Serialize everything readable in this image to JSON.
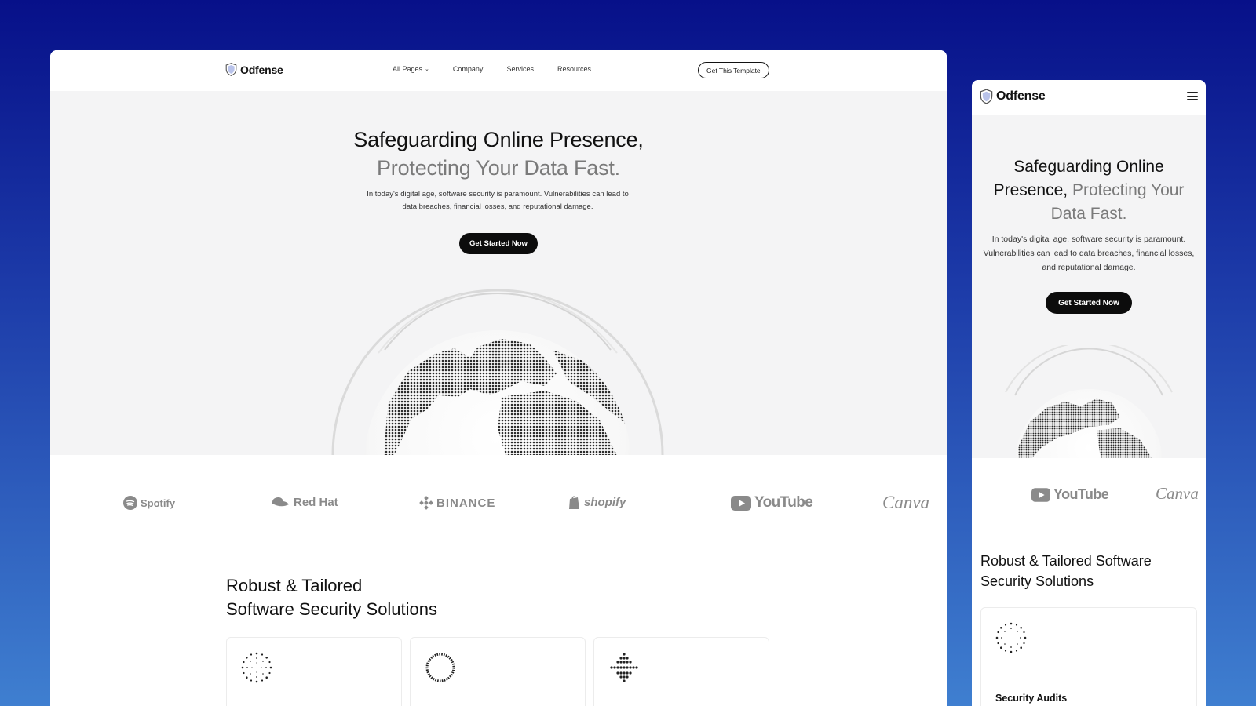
{
  "brand": "Odfense",
  "nav": {
    "links": [
      "All Pages",
      "Company",
      "Services",
      "Resources"
    ],
    "cta": "Get This Template"
  },
  "hero": {
    "title_line1": "Safeguarding Online Presence,",
    "title_line2": "Protecting Your Data Fast.",
    "mobile_title_part1": "Safeguarding Online Presence,",
    "mobile_title_part2": "Protecting Your Data Fast.",
    "description": "In today's digital age, software security is paramount. Vulnerabilities can lead to data breaches, financial losses, and reputational damage.",
    "button": "Get Started Now"
  },
  "logos": [
    "Spotify",
    "Red Hat",
    "BINANCE",
    "shopify",
    "YouTube",
    "Canva"
  ],
  "section": {
    "title_line1": "Robust & Tailored",
    "title_line2": "Software Security Solutions",
    "mobile_title": "Robust & Tailored Software Security Solutions"
  },
  "cards": [
    {
      "icon": "dotted-burst-icon"
    },
    {
      "icon": "dotted-ring-icon"
    },
    {
      "icon": "dotted-diamond-icon"
    }
  ],
  "mobile_card": {
    "icon": "dotted-burst-icon",
    "title": "Security Audits"
  },
  "colors": {
    "background_top": "#071089",
    "background_bottom": "#3f7fd0",
    "hero_bg": "#f4f4f5",
    "button_dark": "#0c0c0c",
    "muted_text": "#7a7a7a",
    "logo_grey": "#8a8a8a"
  }
}
